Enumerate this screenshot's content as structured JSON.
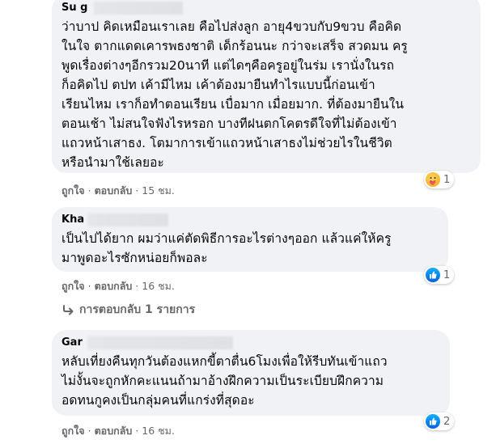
{
  "comments": [
    {
      "author": "Su g",
      "lines": [
        "ว่าบาป คิดเหมือนเราเลย คือไปส่งลูก อายุ4ขวบกับ9ขวบ คือคิด",
        "ในใจ ตากแดดเคารพธงชาติ เด็กร้อนนะ กว่าจะเสร็จ สวดมน ครู",
        "พูดเรื่องต่างๆอีกรวม20นาที แต่ไดๆคือครูอยู่ในร่ม เรานั่งในรถ",
        "ก็อคิดไป ตปท เค้ามีไหม เค้าต้องมายืนทำไรแบบนี้ก่อนเข้า",
        "เรียนไหม เราก็อทำตอนเรียน เบื่อมาก เมื่อยมาก. ที่ต้องมายืนใน",
        "ตอนเช้า ไม่สนใจฟังไรหรอก บางทีฝนตกโคตรดีใจที่ไม่ต้องเข้า",
        "แถวหน้าเสาธง. โตมาการเข้าแถวหน้าเสาธงไม่ช่วยไรในชีวิต",
        "หรือนำมาใช้เลยอะ"
      ],
      "like_label": "ถูกใจ",
      "reply_label": "ตอบกลับ",
      "time": "15 ชม.",
      "reaction_count": "1",
      "reaction_icon": "care-reaction-icon"
    },
    {
      "author": "Kha",
      "lines": [
        "เป็นไปได้ยาก ผมว่าแค่ตัดพิธีการอะไรต่างๆออก แล้วแค่ให้ครู",
        "มาพูดอะไรซักหน่อยก็พอละ"
      ],
      "like_label": "ถูกใจ",
      "reply_label": "ตอบกลับ",
      "time": "16 ชม.",
      "reaction_count": "1",
      "reaction_icon": "like-reaction-icon"
    },
    {
      "author": "Gar",
      "lines": [
        "หลับเที่ยงคืนทุกวันต้องแหกขี้ตาตื่น6โมงเพื่อให้รีบทันเข้าแถว",
        "ไม่งั้นจะถูกหักคะแนนถ้ามาอ้างฝึกความเป็นระเบียบฝึกความ",
        "อดทนกูคงเป็นกลุ่มคนที่แกร่งที่สุดอะ"
      ],
      "like_label": "ถูกใจ",
      "reply_label": "ตอบกลับ",
      "time": "16 ชม.",
      "reaction_count": "2",
      "reaction_icon": "like-reaction-icon"
    }
  ],
  "replies_link": {
    "label": "การตอบกลับ 1 รายการ",
    "icon": "reply-arrow-icon"
  },
  "colors": {
    "bubble": "#f0f2f5",
    "meta_text": "#65676b",
    "like_blue": "#1877f2"
  }
}
